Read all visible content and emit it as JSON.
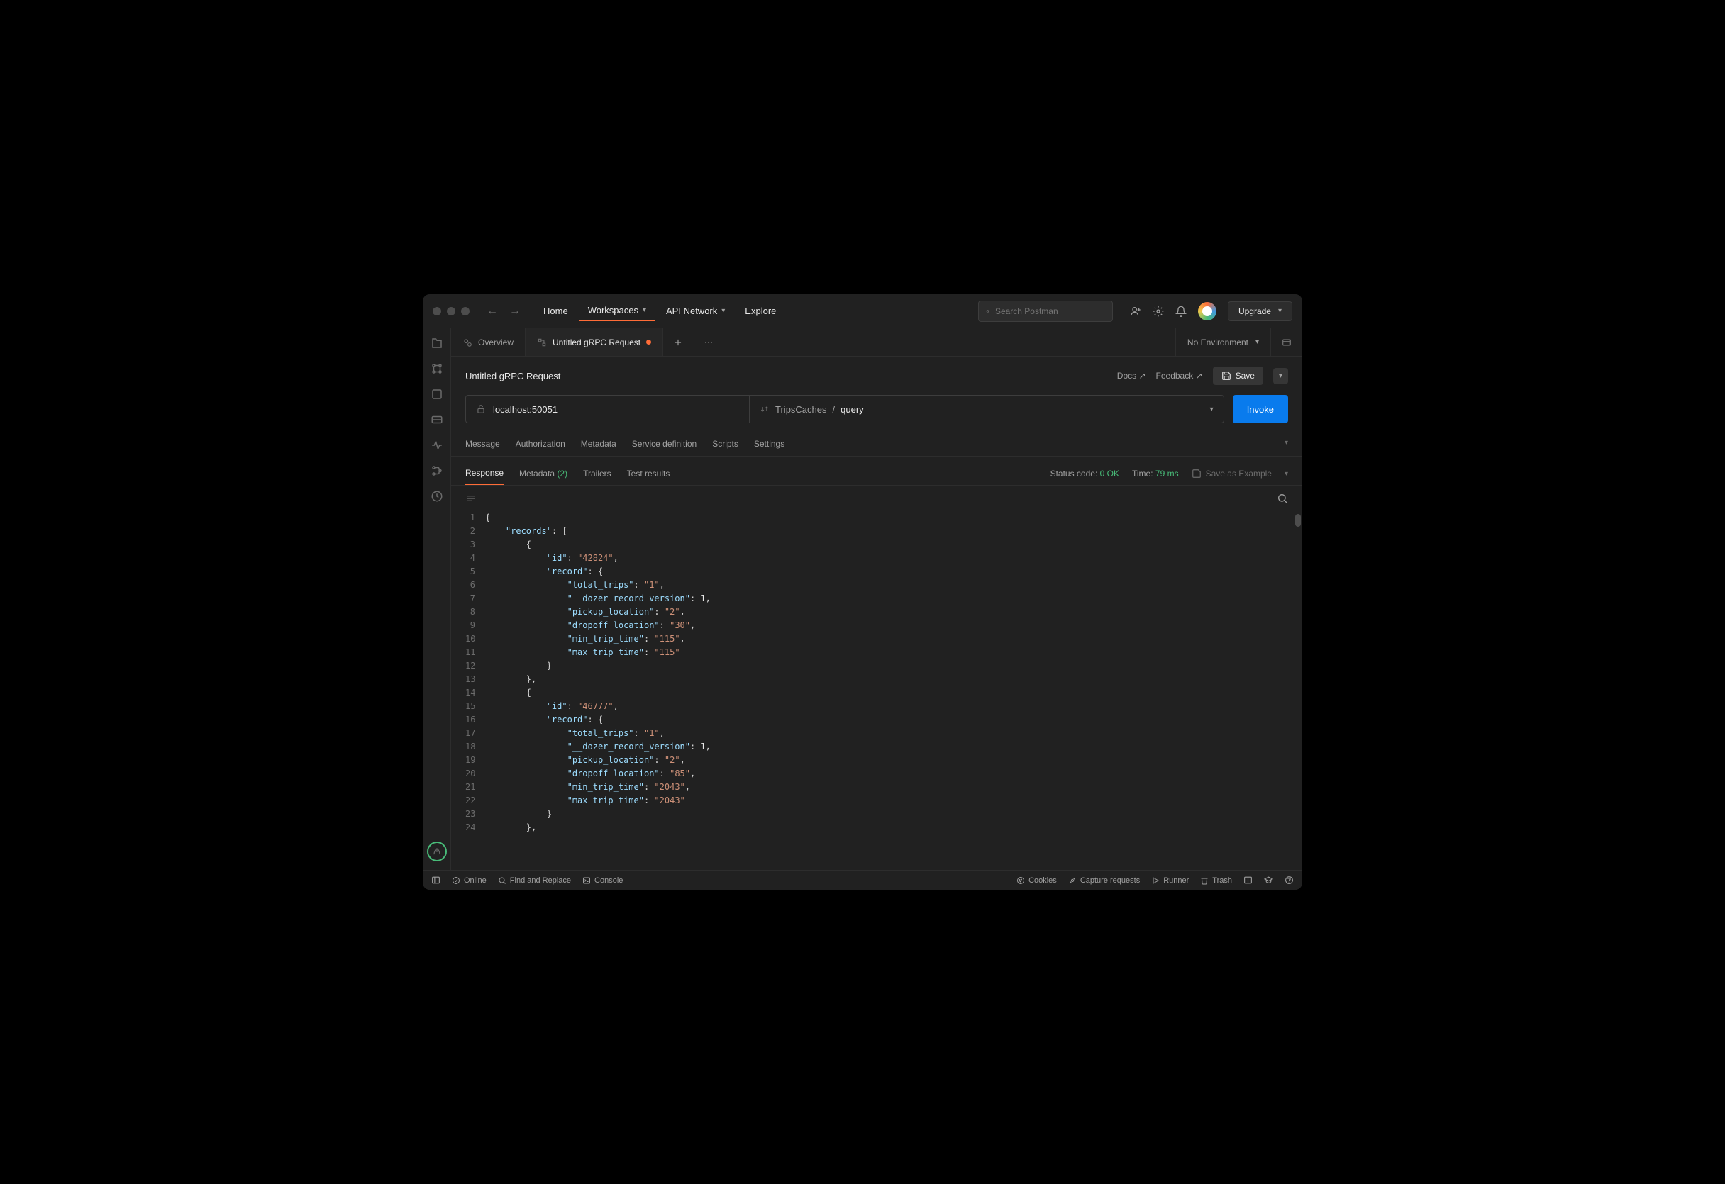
{
  "titlebar": {
    "nav": {
      "home": "Home",
      "workspaces": "Workspaces",
      "apiNetwork": "API Network",
      "explore": "Explore"
    },
    "search_placeholder": "Search Postman",
    "upgrade": "Upgrade"
  },
  "tabs": {
    "overview": "Overview",
    "grpc": "Untitled gRPC Request",
    "env": "No Environment"
  },
  "request": {
    "title": "Untitled gRPC Request",
    "docs": "Docs ↗",
    "feedback": "Feedback ↗",
    "save": "Save",
    "url": "localhost:50051",
    "service": "TripsCaches",
    "sep": " / ",
    "method": "query",
    "invoke": "Invoke",
    "tabs": {
      "message": "Message",
      "authorization": "Authorization",
      "metadata": "Metadata",
      "serviceDef": "Service definition",
      "scripts": "Scripts",
      "settings": "Settings"
    }
  },
  "response": {
    "tabs": {
      "response": "Response",
      "metadata": "Metadata ",
      "metadata_count": "(2)",
      "trailers": "Trailers",
      "testResults": "Test results"
    },
    "status_label": "Status code:",
    "status_val": "0 OK",
    "time_label": "Time:",
    "time_val": "79 ms",
    "save_example": "Save as Example"
  },
  "statusbar": {
    "online": "Online",
    "findReplace": "Find and Replace",
    "console": "Console",
    "cookies": "Cookies",
    "capture": "Capture requests",
    "runner": "Runner",
    "trash": "Trash"
  },
  "code": {
    "records": [
      {
        "id": "42824",
        "record": {
          "total_trips": "1",
          "__dozer_record_version": 1,
          "pickup_location": "2",
          "dropoff_location": "30",
          "min_trip_time": "115",
          "max_trip_time": "115"
        }
      },
      {
        "id": "46777",
        "record": {
          "total_trips": "1",
          "__dozer_record_version": 1,
          "pickup_location": "2",
          "dropoff_location": "85",
          "min_trip_time": "2043",
          "max_trip_time": "2043"
        }
      }
    ]
  }
}
